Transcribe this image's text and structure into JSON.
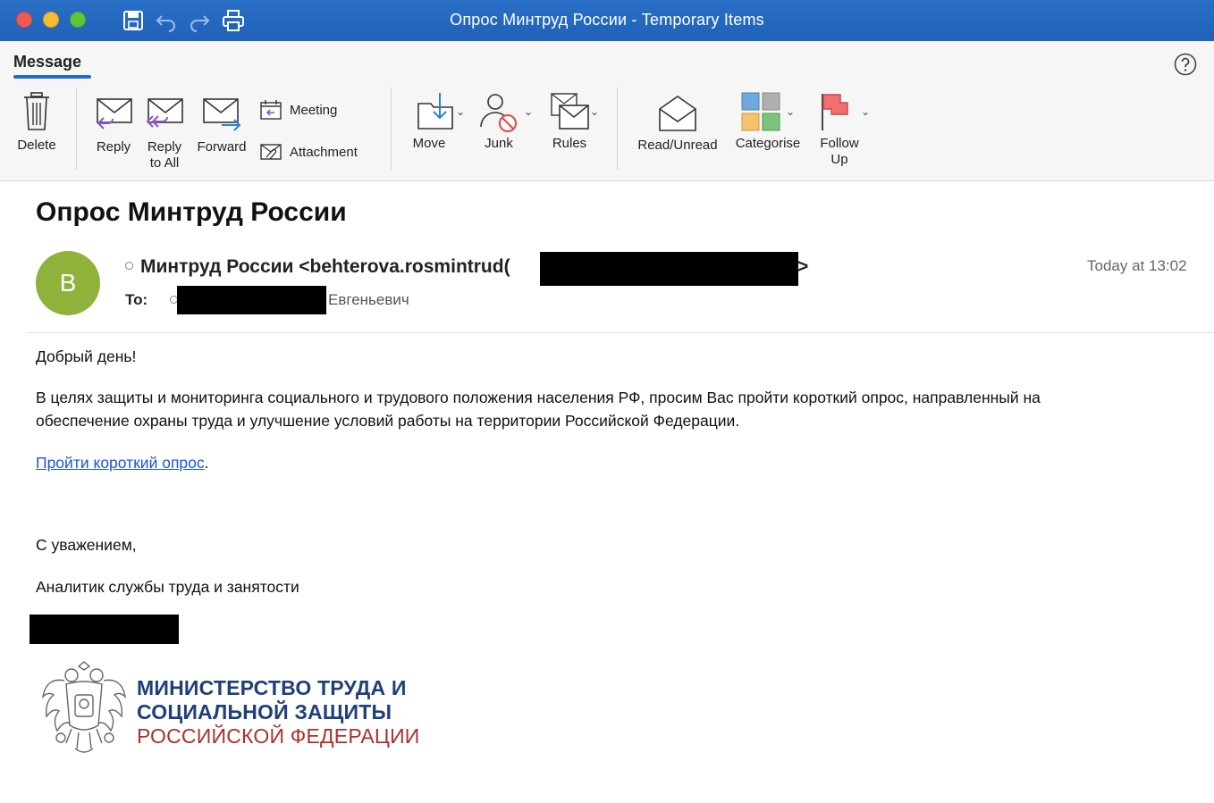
{
  "window": {
    "title": "Опрос Минтруд России - Temporary Items"
  },
  "ribbon": {
    "tab": "Message",
    "buttons": {
      "delete": "Delete",
      "reply": "Reply",
      "reply_all_line1": "Reply",
      "reply_all_line2": "to All",
      "forward": "Forward",
      "meeting": "Meeting",
      "attachment": "Attachment",
      "move": "Move",
      "junk": "Junk",
      "rules": "Rules",
      "read_unread": "Read/Unread",
      "categorise": "Categorise",
      "follow_up_line1": "Follow",
      "follow_up_line2": "Up"
    }
  },
  "message": {
    "subject": "Опрос Минтруд России",
    "avatar_letter": "B",
    "sender_visible": "Минтруд России <behterova.rosmintrud(",
    "sender_suffix": ">",
    "to_label": "To:",
    "to_name_visible": "Евгеньевич",
    "time": "Today at 13:02"
  },
  "body": {
    "greeting": "Добрый день!",
    "paragraph_line1": "В целях защиты и мониторинга социального и трудового положения населения РФ, просим Вас пройти короткий опрос, направленный на",
    "paragraph_line2": "обеспечение охраны труда и улучшение условий работы на территории Российской Федерации.",
    "link_text": "Пройти короткий опрос",
    "link_suffix": ".",
    "closing": "С уважением,",
    "signature_title": "Аналитик службы труда и занятости"
  },
  "logo": {
    "line1": "МИНИСТЕРСТВО ТРУДА И",
    "line2": "СОЦИАЛЬНОЙ ЗАЩИТЫ",
    "line3": "РОССИЙСКОЙ ФЕДЕРАЦИИ"
  },
  "colors": {
    "titlebar": "#2a6fc6",
    "accent": "#1f6fd1",
    "avatar": "#8fb23a",
    "link": "#1a55d8",
    "ministry_blue": "#1e3f78",
    "ministry_red": "#a8322f"
  }
}
